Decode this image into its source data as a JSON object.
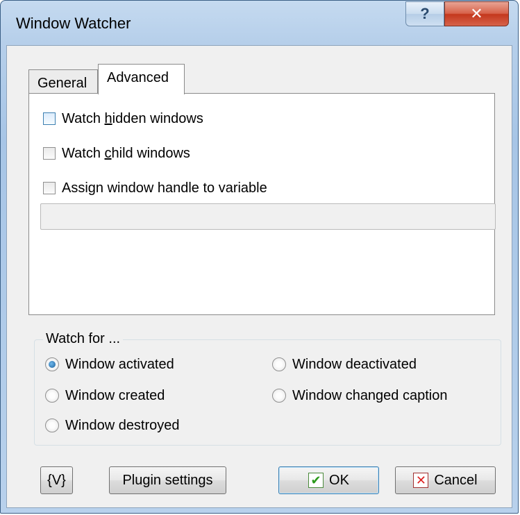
{
  "window": {
    "title": "Window Watcher",
    "help_glyph": "?",
    "close_glyph": "✕"
  },
  "tabs": [
    {
      "label": "General",
      "selected": false
    },
    {
      "label": "Advanced",
      "selected": true
    }
  ],
  "advanced": {
    "watch_hidden": {
      "label_pre": "Watch ",
      "label_mnemonic": "h",
      "label_post": "idden windows",
      "checked": false
    },
    "watch_child": {
      "label_pre": "Watch ",
      "label_mnemonic": "c",
      "label_post": "hild windows",
      "checked": false
    },
    "assign_handle": {
      "label": "Assign window handle to variable",
      "checked": false
    },
    "variable_value": ""
  },
  "watch_for": {
    "legend": "Watch for ...",
    "options": [
      {
        "label": "Window activated",
        "checked": true
      },
      {
        "label": "Window deactivated",
        "checked": false
      },
      {
        "label": "Window created",
        "checked": false
      },
      {
        "label": "Window changed caption",
        "checked": false
      },
      {
        "label": "Window destroyed",
        "checked": false
      }
    ]
  },
  "buttons": {
    "variable": "{V}",
    "plugin_settings": "Plugin settings",
    "ok": "OK",
    "cancel": "Cancel",
    "ok_icon": "check-icon",
    "cancel_icon": "x-icon"
  },
  "colors": {
    "frame": "#b6cfea",
    "close_button": "#c4381d",
    "ok_check": "#2b9a1a",
    "cancel_x": "#dd2222"
  }
}
